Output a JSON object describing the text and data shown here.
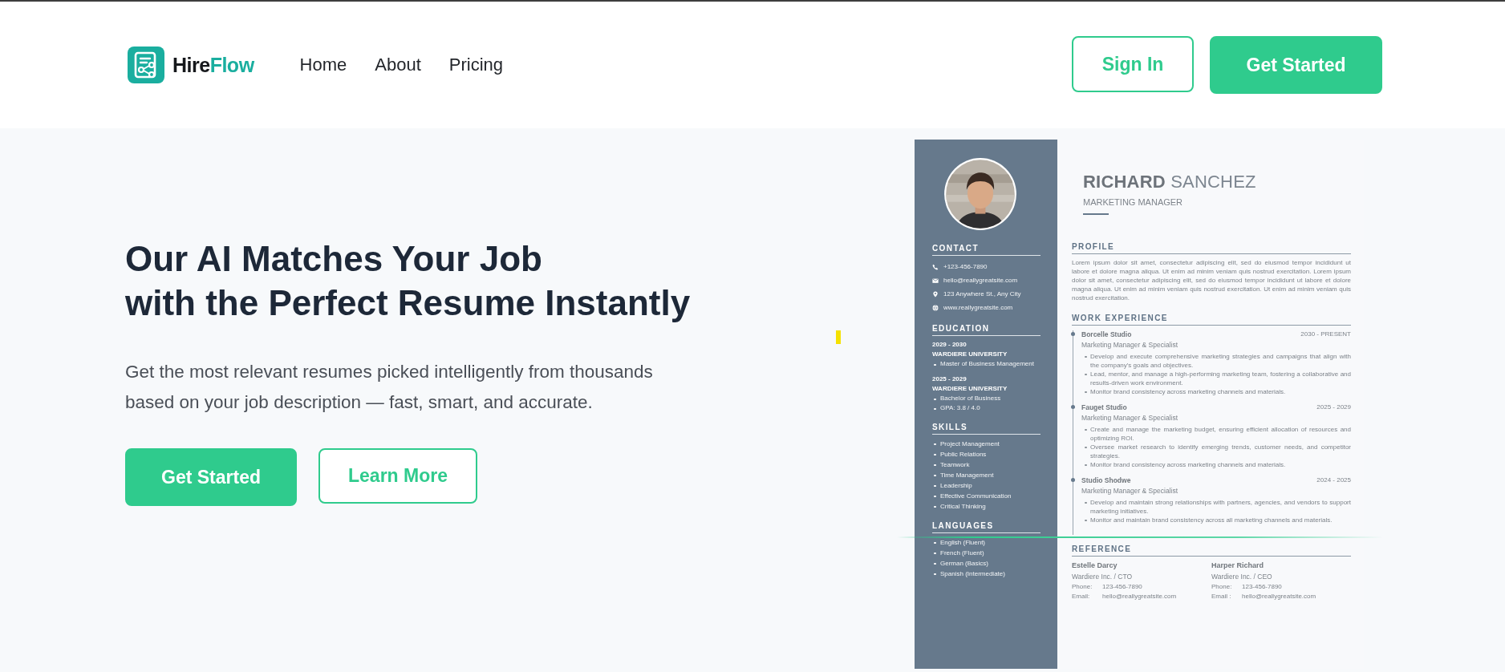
{
  "header": {
    "logo": {
      "part_1": "Hire",
      "part_2": "Flow"
    },
    "nav": [
      {
        "label": "Home"
      },
      {
        "label": "About"
      },
      {
        "label": "Pricing"
      }
    ],
    "sign_in": "Sign In",
    "get_started": "Get Started"
  },
  "hero": {
    "heading": [
      "Our AI Matches Your Job",
      "with the Perfect Resume Instantly"
    ],
    "description": [
      "Get the most relevant resumes picked intelligently from thousands",
      "based on your job description — fast, smart, and accurate."
    ],
    "primary_button": "Get Started",
    "secondary_button": "Learn More"
  },
  "resume": {
    "first_name": "RICHARD",
    "last_name": "SANCHEZ",
    "title": "MARKETING MANAGER",
    "contact": {
      "heading": "CONTACT",
      "items": [
        {
          "kind": "phone",
          "text": "+123-456-7890"
        },
        {
          "kind": "email",
          "text": "hello@reallygreatsite.com"
        },
        {
          "kind": "address",
          "text": "123 Anywhere St., Any City"
        },
        {
          "kind": "web",
          "text": "www.reallygreatsite.com"
        }
      ]
    },
    "education": {
      "heading": "EDUCATION",
      "entries": [
        {
          "years": "2029 - 2030",
          "school": "WARDIERE UNIVERSITY",
          "items": [
            "Master of Business Management"
          ]
        },
        {
          "years": "2025 - 2029",
          "school": "WARDIERE UNIVERSITY",
          "items": [
            "Bachelor of Business",
            "GPA: 3.8 / 4.0"
          ]
        }
      ]
    },
    "skills": {
      "heading": "SKILLS",
      "items": [
        "Project Management",
        "Public Relations",
        "Teamwork",
        "Time Management",
        "Leadership",
        "Effective Communication",
        "Critical Thinking"
      ]
    },
    "languages": {
      "heading": "LANGUAGES",
      "items": [
        "English (Fluent)",
        "French (Fluent)",
        "German (Basics)",
        "Spanish (Intermediate)"
      ]
    },
    "profile": {
      "heading": "PROFILE",
      "text": "Lorem ipsum dolor sit amet, consectetur adipiscing elit, sed do eiusmod tempor incididunt ut labore et dolore magna aliqua. Ut enim ad minim veniam quis nostrud exercitation. Lorem ipsum dolor sit amet, consectetur adipiscing elit, sed do eiusmod tempor incididunt ut labore et dolore magna aliqua. Ut enim ad minim veniam quis nostrud exercitation. Ut enim ad minim veniam quis nostrud exercitation."
    },
    "work": {
      "heading": "WORK EXPERIENCE",
      "jobs": [
        {
          "company": "Borcelle Studio",
          "dates": "2030 - PRESENT",
          "role": "Marketing Manager & Specialist",
          "bullets": [
            "Develop and execute comprehensive marketing strategies and campaigns that align with the company's goals and objectives.",
            "Lead, mentor, and manage a high-performing marketing team, fostering a collaborative and results-driven work environment.",
            "Monitor brand consistency across marketing channels and materials."
          ]
        },
        {
          "company": "Fauget Studio",
          "dates": "2025 - 2029",
          "role": "Marketing Manager & Specialist",
          "bullets": [
            "Create and manage the marketing budget, ensuring efficient allocation of resources and optimizing ROI.",
            "Oversee market research to identify emerging trends, customer needs, and competitor strategies.",
            "Monitor brand consistency across marketing channels and materials."
          ]
        },
        {
          "company": "Studio Shodwe",
          "dates": "2024 - 2025",
          "role": "Marketing Manager & Specialist",
          "bullets": [
            "Develop and maintain strong relationships with partners, agencies, and vendors to support marketing initiatives.",
            "Monitor and maintain brand consistency across all marketing channels and materials."
          ]
        }
      ]
    },
    "reference": {
      "heading": "REFERENCE",
      "people": [
        {
          "name": "Estelle Darcy",
          "company": "Wardiere Inc. / CTO",
          "phone_label": "Phone:",
          "phone": "123-456-7890",
          "email_label": "Email:",
          "email": "hello@reallygreatsite.com"
        },
        {
          "name": "Harper Richard",
          "company": "Wardiere Inc. / CEO",
          "phone_label": "Phone:",
          "phone": "123-456-7890",
          "email_label": "Email :",
          "email": "hello@reallygreatsite.com"
        }
      ]
    }
  }
}
